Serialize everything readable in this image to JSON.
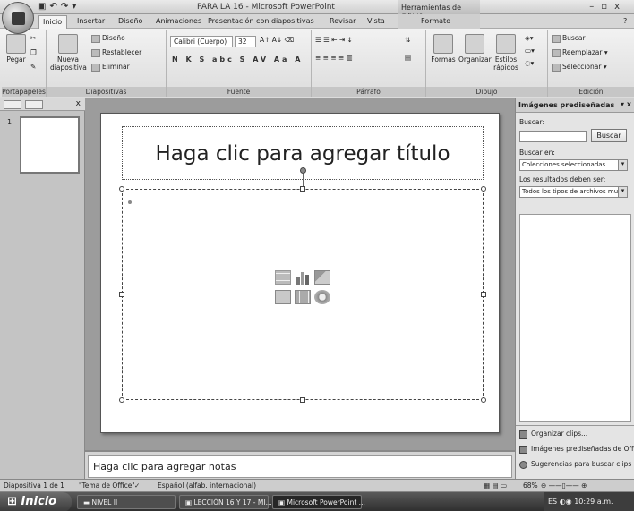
{
  "app": {
    "window_title": "PARA LA 16 - Microsoft PowerPoint",
    "contextual_tab_header": "Herramientas de dibujo",
    "qat_icons": [
      "save-icon",
      "undo-icon",
      "redo-icon"
    ]
  },
  "tabs": [
    "Inicio",
    "Insertar",
    "Diseño",
    "Animaciones",
    "Presentación con diapositivas",
    "Revisar",
    "Vista",
    "Formato"
  ],
  "ribbon": {
    "clipboard": {
      "label": "Portapapeles",
      "paste": "Pegar"
    },
    "slides": {
      "label": "Diapositivas",
      "new_slide": "Nueva diapositiva",
      "layout": "Diseño",
      "reset": "Restablecer",
      "delete": "Eliminar"
    },
    "font": {
      "label": "Fuente",
      "font_name": "Calibri (Cuerpo)",
      "font_size": "32",
      "buttons": "N K S abc S AV Aa A"
    },
    "paragraph": {
      "label": "Párrafo"
    },
    "drawing": {
      "label": "Dibujo",
      "shapes": "Formas",
      "arrange": "Organizar",
      "quick_styles": "Estilos rápidos"
    },
    "editing": {
      "label": "Edición",
      "find": "Buscar",
      "replace": "Reemplazar",
      "select": "Seleccionar"
    }
  },
  "slide_panel": {
    "slide_number": "1"
  },
  "slide": {
    "title_placeholder": "Haga clic para agregar título"
  },
  "notes": {
    "placeholder": "Haga clic para agregar notas"
  },
  "task_pane": {
    "title": "Imágenes prediseñadas",
    "search_label": "Buscar:",
    "search_button": "Buscar",
    "search_in_label": "Buscar en:",
    "search_in_value": "Colecciones seleccionadas",
    "results_label": "Los resultados deben ser:",
    "results_value": "Todos los tipos de archivos mult",
    "links": [
      "Organizar clips...",
      "Imágenes prediseñadas de Office",
      "Sugerencias para buscar clips"
    ]
  },
  "statusbar": {
    "slide_info": "Diapositiva 1 de 1",
    "theme": "\"Tema de Office\"",
    "language": "Español (alfab. internacional)",
    "zoom": "68%"
  },
  "taskbar": {
    "start": "Inicio",
    "tasks": [
      "NIVEL II",
      "LECCIÓN 16 Y 17 - MI...",
      "Microsoft PowerPoint ..."
    ],
    "lang": "ES",
    "time": "10:29 a.m."
  }
}
